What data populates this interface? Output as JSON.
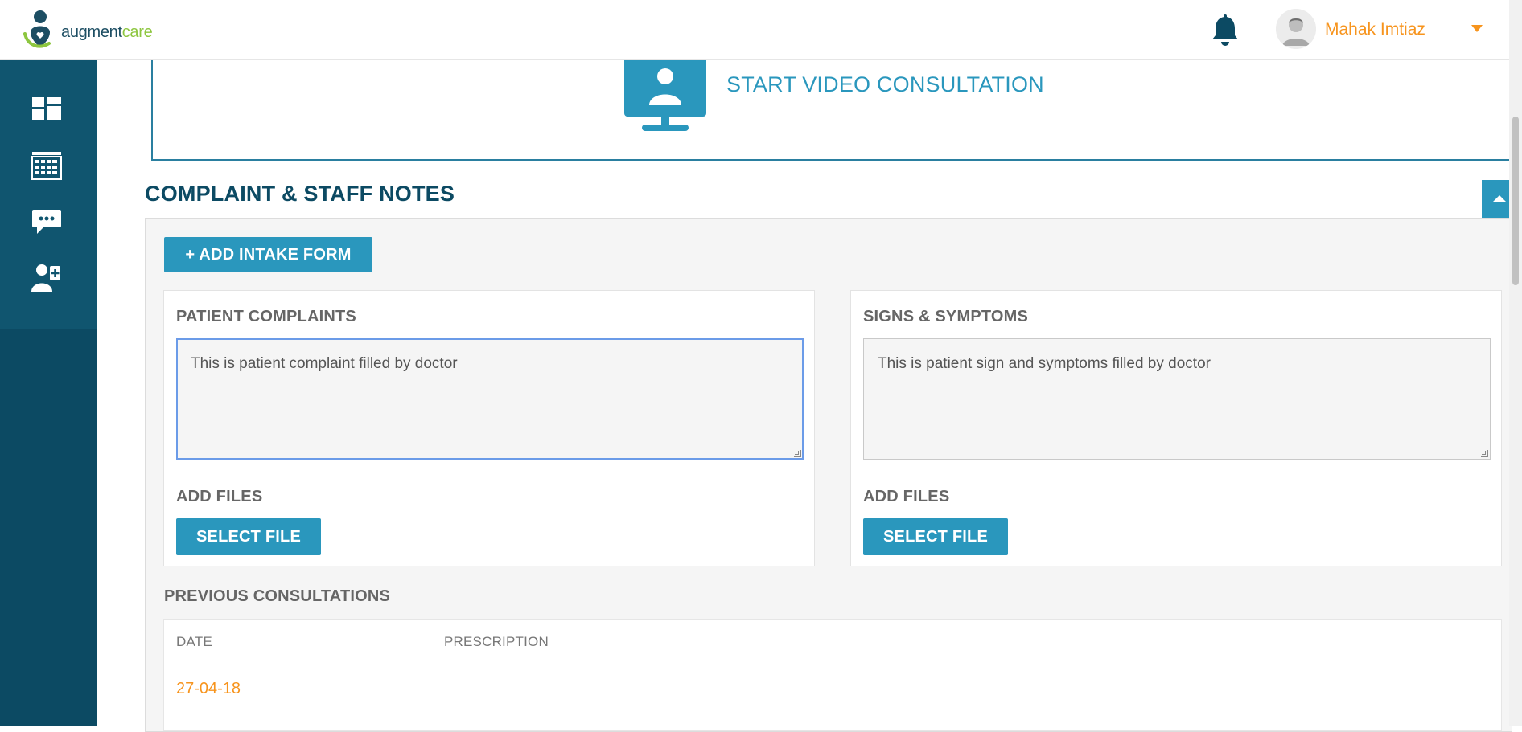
{
  "header": {
    "logo_part1": "augment",
    "logo_part2": "care",
    "user_name": "Mahak Imtiaz",
    "icons": [
      "notification-bell-icon",
      "user-avatar",
      "caret-down-icon"
    ]
  },
  "sidebar": {
    "items": [
      {
        "name": "dashboard",
        "icon": "dashboard-icon"
      },
      {
        "name": "calendar",
        "icon": "calendar-icon"
      },
      {
        "name": "messages",
        "icon": "chat-icon"
      },
      {
        "name": "doctor",
        "icon": "doctor-icon"
      }
    ]
  },
  "video": {
    "label": "START VIDEO CONSULTATION",
    "icon": "video-monitor-icon"
  },
  "section": {
    "title": "COMPLAINT & STAFF NOTES",
    "intake_button": "+ ADD INTAKE FORM"
  },
  "complaints": {
    "title": "PATIENT COMPLAINTS",
    "value": "This is patient complaint filled by doctor",
    "add_files": "ADD FILES",
    "select_file": "SELECT FILE"
  },
  "symptoms": {
    "title": "SIGNS & SYMPTOMS",
    "value": "This is patient sign and symptoms filled by doctor",
    "add_files": "ADD FILES",
    "select_file": "SELECT FILE"
  },
  "previous": {
    "title": "PREVIOUS CONSULTATIONS",
    "columns": [
      "DATE",
      "PRESCRIPTION"
    ],
    "rows": [
      {
        "date": "27-04-18",
        "prescription": ""
      }
    ]
  },
  "colors": {
    "primary": "#2a97bd",
    "sidebar": "#0c4a63",
    "accent": "#f7941d"
  }
}
